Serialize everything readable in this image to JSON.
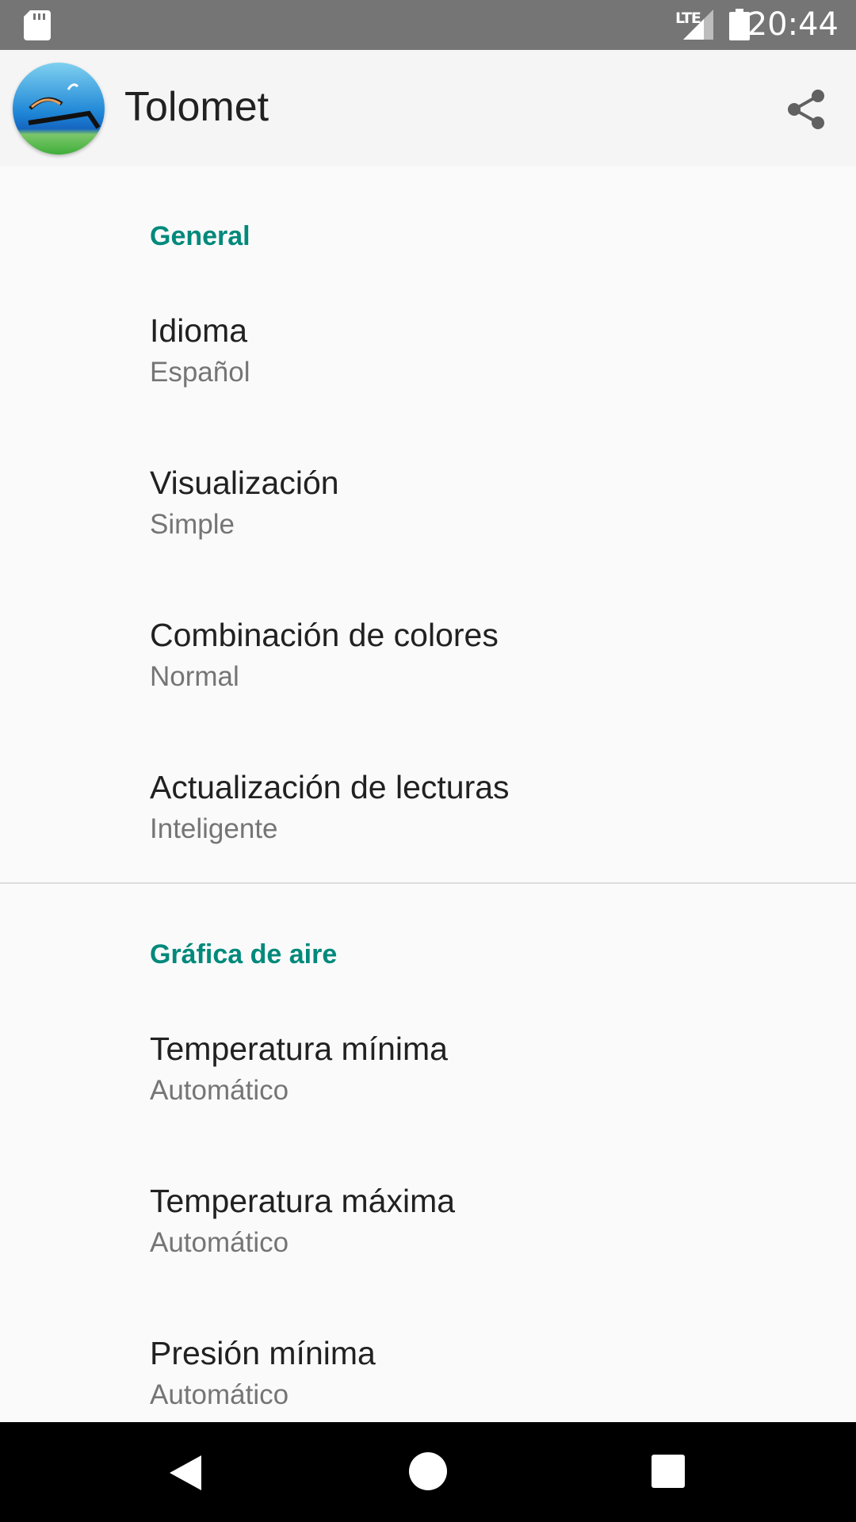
{
  "status_bar": {
    "time": "20:44",
    "network": "LTE",
    "icons": [
      "sd-card-icon",
      "signal-icon",
      "battery-icon"
    ]
  },
  "app_bar": {
    "title": "Tolomet",
    "logo": "tolomet-logo",
    "share_icon": "share-icon"
  },
  "sections": [
    {
      "header": "General",
      "items": [
        {
          "title": "Idioma",
          "summary": "Español"
        },
        {
          "title": "Visualización",
          "summary": "Simple"
        },
        {
          "title": "Combinación de colores",
          "summary": "Normal"
        },
        {
          "title": "Actualización de lecturas",
          "summary": "Inteligente"
        }
      ]
    },
    {
      "header": "Gráfica de aire",
      "items": [
        {
          "title": "Temperatura mínima",
          "summary": "Automático"
        },
        {
          "title": "Temperatura máxima",
          "summary": "Automático"
        },
        {
          "title": "Presión mínima",
          "summary": "Automático"
        }
      ]
    }
  ],
  "colors": {
    "accent": "#00897b",
    "status_bar": "#757575",
    "app_bar": "#f5f5f5",
    "background": "#fafafa"
  },
  "nav_bar": {
    "icons": [
      "back-icon",
      "home-icon",
      "recents-icon"
    ]
  }
}
